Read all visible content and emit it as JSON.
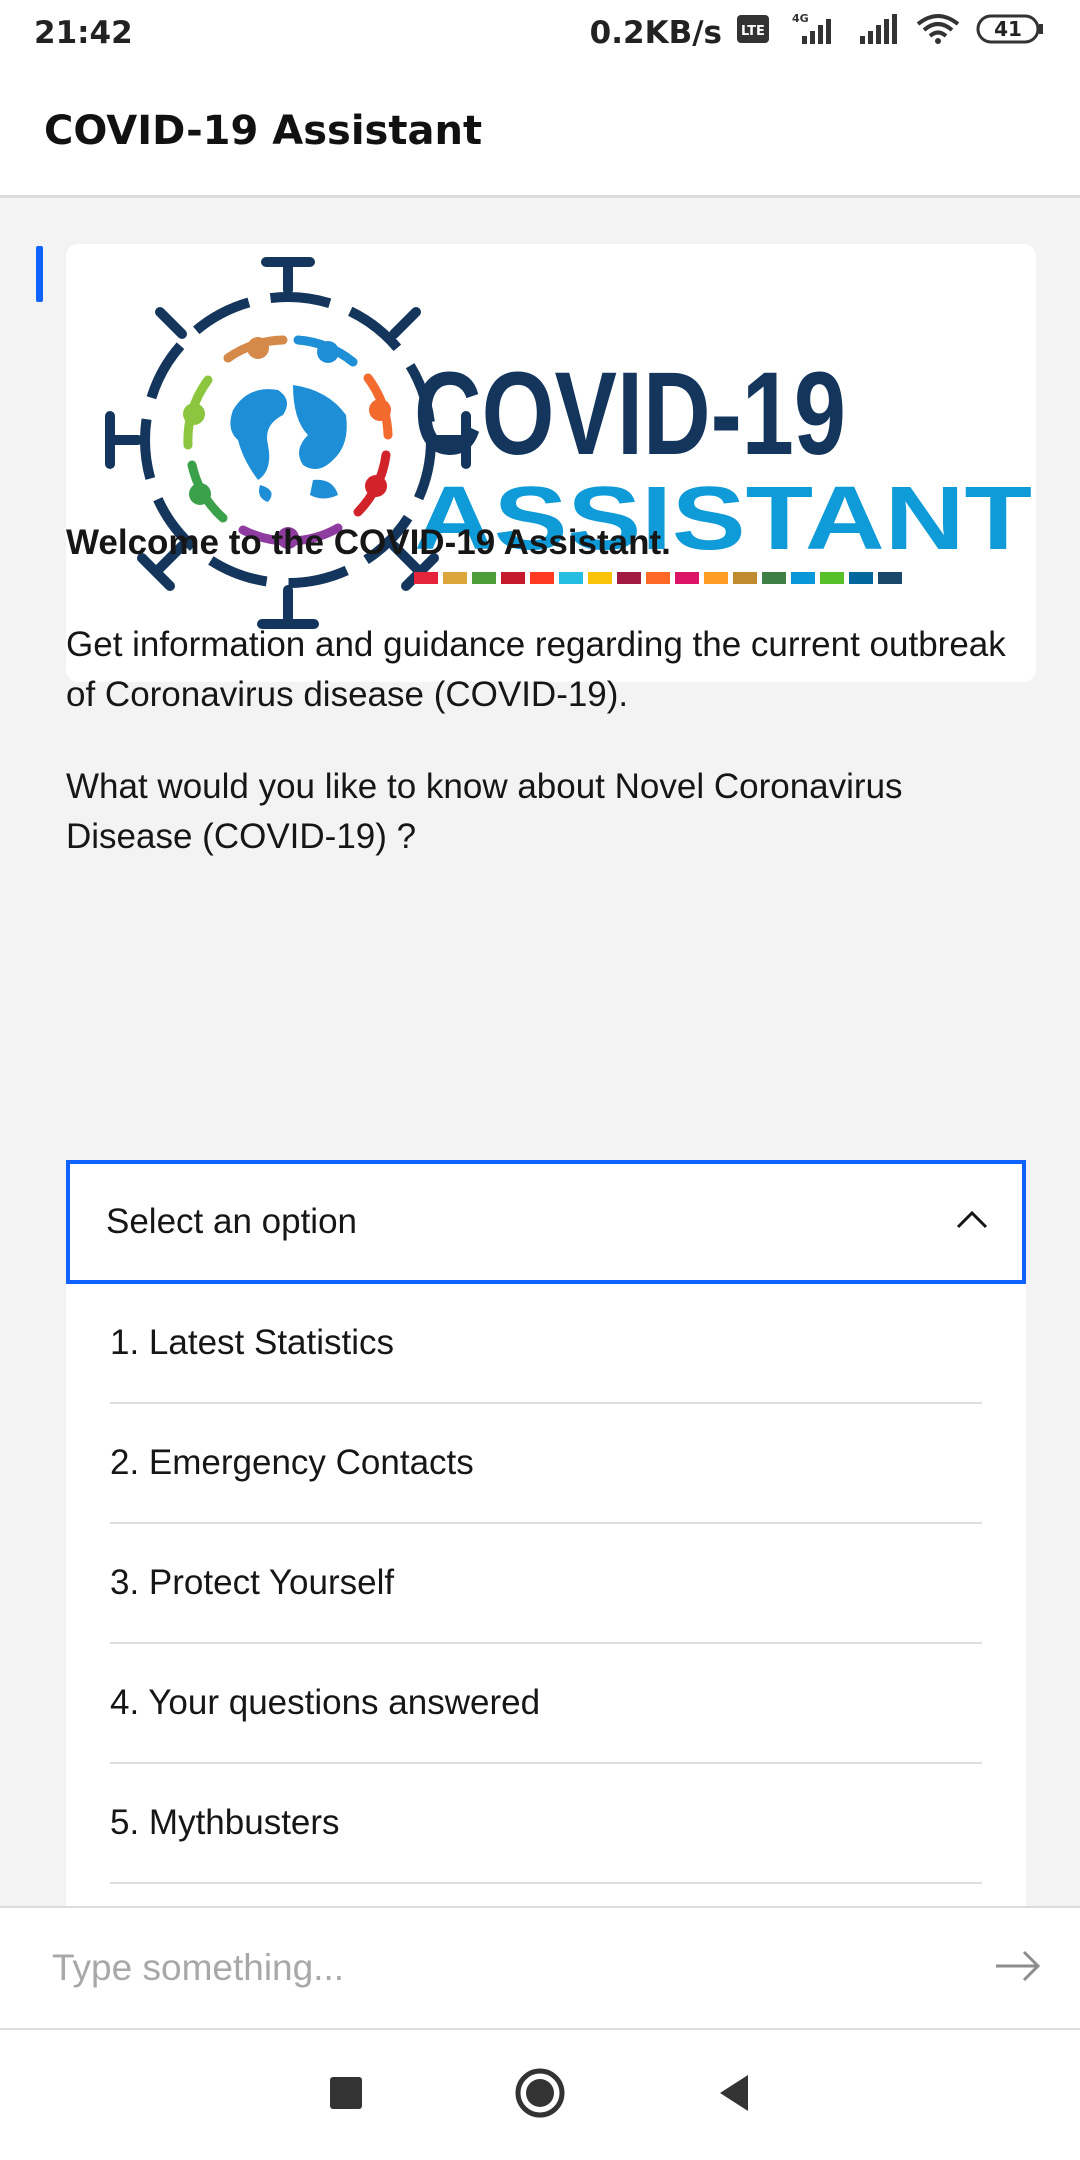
{
  "status_bar": {
    "time": "21:42",
    "net_speed": "0.2KB/s",
    "battery": "41",
    "signal_label": "4G"
  },
  "app_bar": {
    "title": "COVID-19 Assistant"
  },
  "banner": {
    "line1": "COVID-19",
    "line2": "ASSISTANT",
    "stripe_colors": [
      "#e5243b",
      "#dda63a",
      "#4c9f38",
      "#c5192d",
      "#ff3a21",
      "#26bde2",
      "#fcc30b",
      "#a21942",
      "#fd6925",
      "#dd1367",
      "#fd9d24",
      "#bf8b2e",
      "#3f7e44",
      "#0a97d9",
      "#56c02b",
      "#00689d",
      "#19486a"
    ],
    "colors": {
      "navy": "#14365c",
      "blue": "#0f9bd7"
    }
  },
  "messages": {
    "welcome": "Welcome to the COVID-19 Assistant.",
    "info": "Get information and guidance regarding the current outbreak of Coronavirus disease (COVID-19).",
    "question": "What would you like to know about Novel Coronavirus Disease (COVID-19) ?"
  },
  "dropdown": {
    "placeholder": "Select an option",
    "options": [
      "1. Latest Statistics",
      "2. Emergency Contacts",
      "3. Protect Yourself",
      "4. Your questions answered",
      "5. Mythbusters"
    ]
  },
  "input": {
    "placeholder": "Type something..."
  },
  "icons": [
    "chevron-up-icon",
    "send-arrow-icon",
    "nav-recents-icon",
    "nav-home-icon",
    "nav-back-icon",
    "wifi-icon",
    "signal-icon",
    "battery-icon"
  ],
  "colors": {
    "accent": "#0f62fe"
  }
}
